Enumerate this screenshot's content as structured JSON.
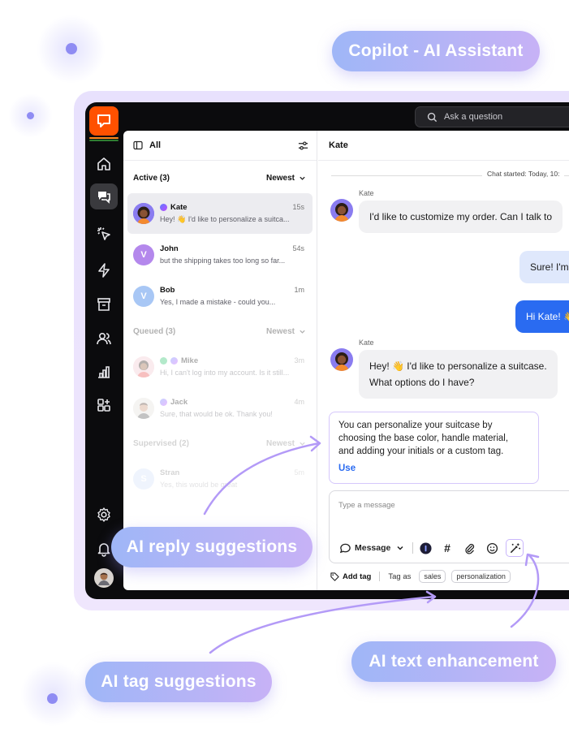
{
  "labels": {
    "copilot": "Copilot - AI Assistant",
    "reply_suggestions": "AI reply suggestions",
    "tag_suggestions": "AI tag suggestions",
    "text_enhancement": "AI text enhancement"
  },
  "topbar": {
    "search_placeholder": "Ask a question"
  },
  "sidebar": {
    "items": [
      "home-icon",
      "chats-icon",
      "engage-icon",
      "automation-icon",
      "archives-icon",
      "team-icon",
      "reports-icon",
      "apps-icon"
    ],
    "bottom": [
      "settings-icon",
      "bell-icon",
      "user-avatar"
    ]
  },
  "list": {
    "filter_label": "All",
    "active": {
      "label": "Active (3)",
      "sort": "Newest"
    },
    "queued": {
      "label": "Queued (3)",
      "sort": "Newest"
    },
    "supervised": {
      "label": "Supervised (2)",
      "sort": "Newest"
    },
    "chats": [
      {
        "name": "Kate",
        "preview": "Hey! 👋 I'd like to personalize a suitca...",
        "time": "15s",
        "initial": ""
      },
      {
        "name": "John",
        "preview": "but the shipping takes too long so far...",
        "time": "54s",
        "initial": "V"
      },
      {
        "name": "Bob",
        "preview": "Yes, I made a mistake - could you...",
        "time": "1m",
        "initial": "V"
      },
      {
        "name": "Mike",
        "preview": "Hi, I can't log into my account. Is it still...",
        "time": "3m",
        "initial": ""
      },
      {
        "name": "Jack",
        "preview": "Sure, that would be ok. Thank you!",
        "time": "4m",
        "initial": ""
      },
      {
        "name": "Stran",
        "preview": "Yes, this would be great",
        "time": "5m",
        "initial": "S"
      }
    ]
  },
  "conversation": {
    "contact": "Kate",
    "started": "Chat started: Today, 10:",
    "messages": [
      {
        "sender": "Kate",
        "text": "I'd like to customize my order. Can I talk to"
      },
      {
        "sender": "",
        "text": "Sure! I'm"
      },
      {
        "sender": "",
        "text": "Hi Kate! 👋"
      },
      {
        "sender": "Kate",
        "line1": "Hey! 👋 I'd like to personalize a suitcase.",
        "line2": "What options do I have?"
      }
    ],
    "suggestion": {
      "line1": "You can personalize your suitcase by",
      "line2": "choosing the base color, handle material,",
      "line3": "and adding your initials or a custom tag.",
      "action": "Use"
    },
    "composer": {
      "placeholder": "Type a message",
      "mode": "Message",
      "hash": "#"
    },
    "tags": {
      "add_label": "Add tag",
      "tag_as": "Tag as",
      "chips": [
        "sales",
        "personalization"
      ]
    }
  },
  "colors": {
    "brand": "#ff5100",
    "accent_blue": "#2a6bf1",
    "ai_border": "#d5c7fb"
  }
}
